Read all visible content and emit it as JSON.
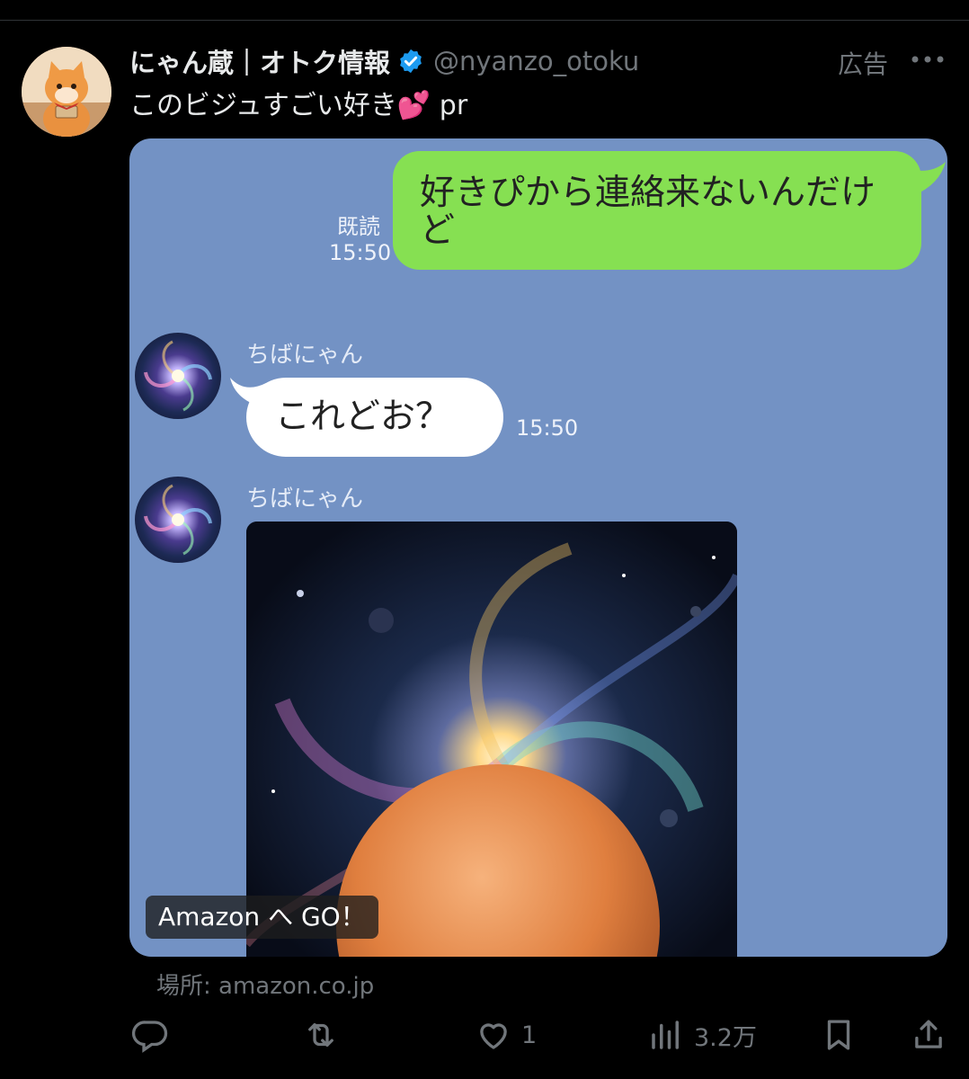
{
  "post": {
    "display_name": "にゃん蔵｜オトク情報",
    "handle": "@nyanzo_otoku",
    "ad_label": "広告",
    "text": "このビジュすごい好き💕 pr",
    "location": "場所: amazon.co.jp"
  },
  "chat": {
    "my_message": "好きぴから連絡来ないんだけど",
    "read_label": "既読",
    "my_time": "15:50",
    "sender_name": "ちばにゃん",
    "reply_message": "これどお？",
    "reply_time": "15:50",
    "sender_name_2": "ちばにゃん"
  },
  "badge": {
    "label": "Amazon へ GO！"
  },
  "actions": {
    "reply_count": "",
    "repost_count": "",
    "like_count": "1",
    "views_count": "3.2万"
  },
  "colors": {
    "background": "#000000",
    "card_background": "#7392c4",
    "green_bubble": "#86e052",
    "verified_badge": "#1d9bf0",
    "muted_text": "#71767b"
  },
  "icons": [
    "verified-icon",
    "more-icon",
    "reply-icon",
    "repost-icon",
    "like-icon",
    "views-icon",
    "bookmark-icon",
    "share-icon"
  ]
}
